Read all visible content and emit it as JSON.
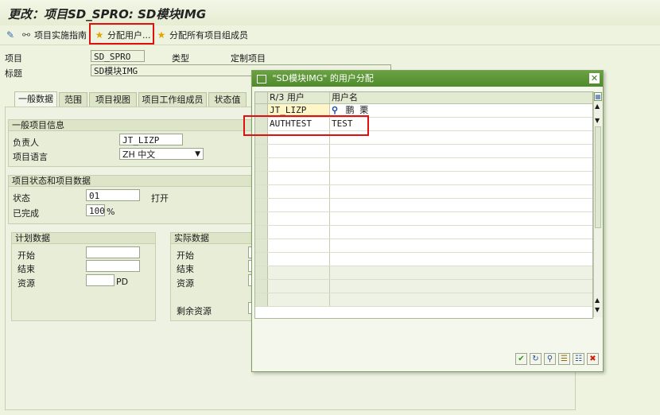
{
  "window": {
    "title": "更改：项目SD_SPRO: SD模块IMG"
  },
  "toolbar": {
    "items": [
      {
        "label": "项目实施指南",
        "icon": "guide-icon"
      },
      {
        "label": "分配用户...",
        "icon": "star-assign-icon"
      },
      {
        "label": "分配所有项目组成员",
        "icon": "star-assign-all-icon"
      }
    ]
  },
  "header": {
    "project_label": "项目",
    "project_value": "SD_SPRO",
    "type_label": "类型",
    "type_value": "定制项目",
    "title_label": "标题",
    "title_value": "SD模块IMG"
  },
  "tabs": [
    "一般数据",
    "范围",
    "项目视图",
    "项目工作组成员",
    "状态值"
  ],
  "general": {
    "section_title": "一般项目信息",
    "owner_label": "负责人",
    "owner_value": "JT_LIZP",
    "lang_label": "项目语言",
    "lang_value": "ZH 中文"
  },
  "status": {
    "section_title": "项目状态和项目数据",
    "status_label": "状态",
    "status_value": "01",
    "status_text": "打开",
    "done_label": "已完成",
    "done_value": "100",
    "done_unit": "%"
  },
  "plan": {
    "title": "计划数据",
    "start": "开始",
    "end": "结束",
    "resource": "资源",
    "resource_unit": "PD"
  },
  "actual": {
    "title": "实际数据",
    "start": "开始",
    "end": "结束",
    "resource": "资源",
    "remaining": "剩余资源"
  },
  "dialog": {
    "title": "\"SD模块IMG\" 的用户分配",
    "col_user": "R/3 用户",
    "col_name": "用户名",
    "rows": [
      {
        "user": "JT_LIZP",
        "name": "鹏 栗"
      },
      {
        "user": "AUTHTEST",
        "name": "TEST"
      }
    ],
    "buttons": [
      "confirm-icon",
      "refresh-icon",
      "find-icon",
      "insert-row-icon",
      "delete-row-icon",
      "cancel-icon"
    ]
  }
}
